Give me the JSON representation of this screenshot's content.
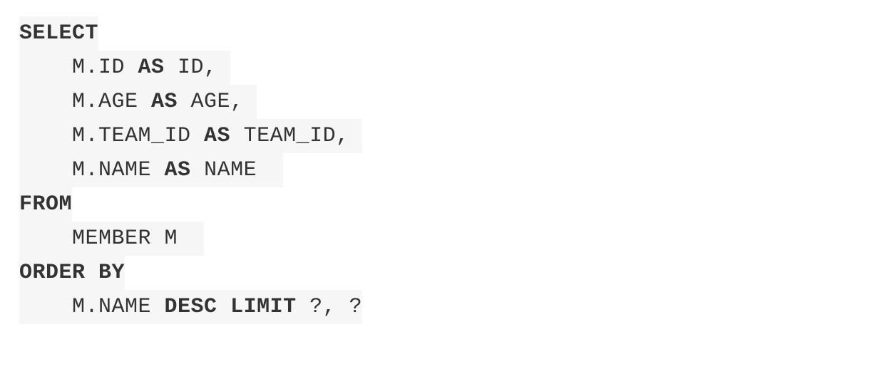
{
  "sql_code": {
    "lines": [
      [
        {
          "text": "SELECT",
          "kw": true
        }
      ],
      [
        {
          "text": "    M.ID ",
          "kw": false
        },
        {
          "text": "AS",
          "kw": true
        },
        {
          "text": " ID, ",
          "kw": false
        }
      ],
      [
        {
          "text": "    M.AGE ",
          "kw": false
        },
        {
          "text": "AS",
          "kw": true
        },
        {
          "text": " AGE, ",
          "kw": false
        }
      ],
      [
        {
          "text": "    M.TEAM_ID ",
          "kw": false
        },
        {
          "text": "AS",
          "kw": true
        },
        {
          "text": " TEAM_ID, ",
          "kw": false
        }
      ],
      [
        {
          "text": "    M.NAME ",
          "kw": false
        },
        {
          "text": "AS",
          "kw": true
        },
        {
          "text": " NAME  ",
          "kw": false
        }
      ],
      [
        {
          "text": "FROM",
          "kw": true
        }
      ],
      [
        {
          "text": "    MEMBER M  ",
          "kw": false
        }
      ],
      [
        {
          "text": "ORDER BY",
          "kw": true
        }
      ],
      [
        {
          "text": "    M.NAME ",
          "kw": false
        },
        {
          "text": "DESC",
          "kw": true
        },
        {
          "text": " ",
          "kw": false
        },
        {
          "text": "LIMIT",
          "kw": true
        },
        {
          "text": " ?, ?",
          "kw": false
        }
      ]
    ]
  }
}
